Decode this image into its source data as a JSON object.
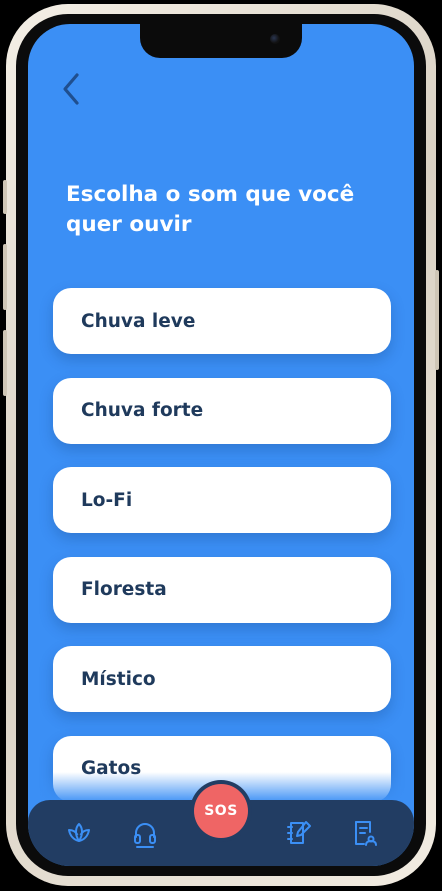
{
  "screen": {
    "title": "Escolha o som que você quer ouvir",
    "background_color": "#3b8ff5"
  },
  "header": {
    "back_icon": "chevron-left-icon"
  },
  "options": [
    {
      "label": "Chuva leve"
    },
    {
      "label": "Chuva forte"
    },
    {
      "label": "Lo-Fi"
    },
    {
      "label": "Floresta"
    },
    {
      "label": "Místico"
    },
    {
      "label": "Gatos"
    }
  ],
  "bottom_nav": {
    "background_color": "#223d63",
    "items": [
      {
        "icon": "lotus-icon"
      },
      {
        "icon": "headphones-icon",
        "active": true
      },
      {
        "icon": "notebook-edit-icon"
      },
      {
        "icon": "document-report-icon"
      }
    ],
    "sos": {
      "label": "SOS",
      "color": "#ef6565"
    }
  },
  "colors": {
    "card_text": "#1f3a5c",
    "nav_icon": "#3b8ff5"
  }
}
